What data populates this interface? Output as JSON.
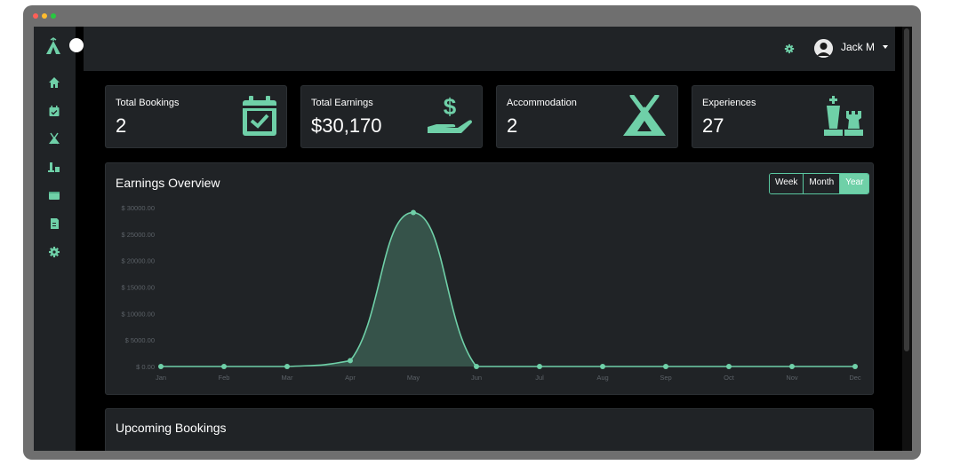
{
  "colors": {
    "accent": "#6fd0a8",
    "panel": "#202326",
    "background": "#000000",
    "tick": "#5c6268"
  },
  "window": {
    "controls": [
      "close",
      "minimize",
      "zoom"
    ]
  },
  "sidebar": {
    "items": [
      {
        "icon": "home-icon"
      },
      {
        "icon": "calendar-icon"
      },
      {
        "icon": "tent-icon"
      },
      {
        "icon": "chess-icon"
      },
      {
        "icon": "wallet-icon"
      },
      {
        "icon": "receipt-icon"
      },
      {
        "icon": "gear-icon"
      }
    ]
  },
  "header": {
    "user_name": "Jack M"
  },
  "stats": [
    {
      "label": "Total Bookings",
      "value": "2",
      "icon": "calendar-check-icon"
    },
    {
      "label": "Total Earnings",
      "value": "$30,170",
      "icon": "hand-dollar-icon"
    },
    {
      "label": "Accommodation",
      "value": "2",
      "icon": "tent-icon"
    },
    {
      "label": "Experiences",
      "value": "27",
      "icon": "chess-pieces-icon"
    }
  ],
  "earnings": {
    "title": "Earnings Overview",
    "tabs": [
      {
        "label": "Week",
        "active": false
      },
      {
        "label": "Month",
        "active": false
      },
      {
        "label": "Year",
        "active": true
      }
    ]
  },
  "chart_data": {
    "type": "area",
    "categories": [
      "Jan",
      "Feb",
      "Mar",
      "Apr",
      "May",
      "Jun",
      "Jul",
      "Aug",
      "Sep",
      "Oct",
      "Nov",
      "Dec"
    ],
    "values": [
      0,
      0,
      0,
      1100,
      29070,
      0,
      0,
      0,
      0,
      0,
      0,
      0
    ],
    "ylim": [
      0,
      30000
    ],
    "yticks": [
      0,
      5000,
      10000,
      15000,
      20000,
      25000,
      30000
    ],
    "ytick_labels": [
      "$ 0.00",
      "$ 5000.00",
      "$ 10000.00",
      "$ 15000.00",
      "$ 20000.00",
      "$ 25000.00",
      "$ 30000.00"
    ],
    "grid": false
  },
  "upcoming": {
    "title": "Upcoming Bookings"
  }
}
